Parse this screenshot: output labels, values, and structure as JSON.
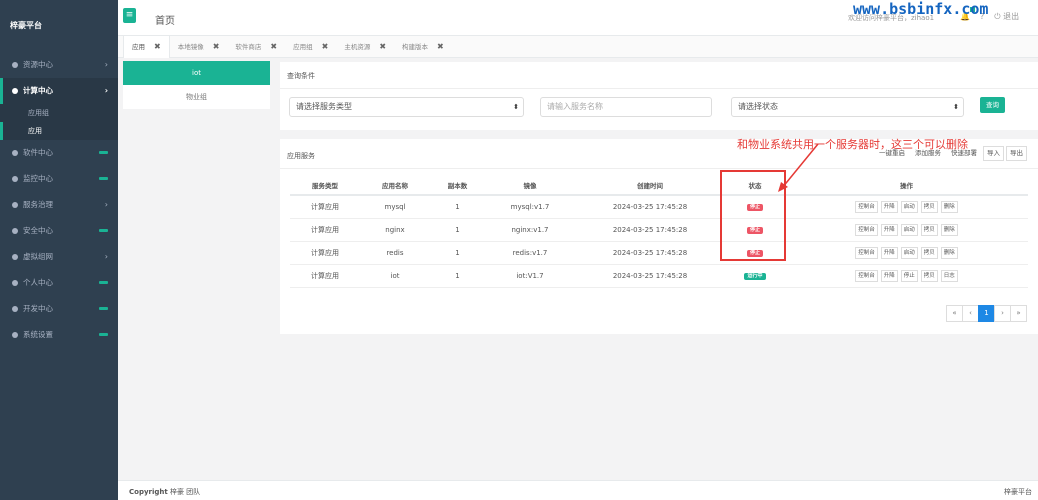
{
  "watermark": "www.bsbinfx.com",
  "sidebar": {
    "brand": "梓豪平台",
    "items": [
      {
        "label": "资源中心",
        "indicator": "arrow"
      },
      {
        "label": "计算中心",
        "indicator": "arrow",
        "active": true
      },
      {
        "label": "软件中心",
        "indicator": "bar"
      },
      {
        "label": "监控中心",
        "indicator": "bar"
      },
      {
        "label": "服务治理",
        "indicator": "arrow"
      },
      {
        "label": "安全中心",
        "indicator": "bar"
      },
      {
        "label": "虚拟组网",
        "indicator": "arrow"
      },
      {
        "label": "个人中心",
        "indicator": "bar"
      },
      {
        "label": "开发中心",
        "indicator": "bar"
      },
      {
        "label": "系统设置",
        "indicator": "bar"
      }
    ],
    "subitems": [
      "应用组",
      "应用"
    ],
    "arrow_glyph": "›"
  },
  "header": {
    "menu_icon": "≡",
    "title": "首页",
    "welcome": "欢迎访问梓豪平台，zihao1",
    "logout": "退出"
  },
  "tabs": [
    {
      "label": "应用",
      "active": true
    },
    {
      "label": "本地镜像"
    },
    {
      "label": "软件商店"
    },
    {
      "label": "应用组"
    },
    {
      "label": "主机资源"
    },
    {
      "label": "构建版本"
    }
  ],
  "tab_close": "✖",
  "left_panel": {
    "items": [
      "iot",
      "物业组"
    ]
  },
  "query": {
    "title": "查询条件",
    "service_type_placeholder": "请选择服务类型",
    "service_name_placeholder": "请输入服务名称",
    "status_placeholder": "请选择状态",
    "search_button": "查询",
    "caret": "⬍"
  },
  "services": {
    "title": "应用服务",
    "actions": [
      "一键重启",
      "添加服务",
      "快速部署",
      "导入",
      "导出"
    ],
    "columns": [
      "服务类型",
      "应用名称",
      "副本数",
      "镜像",
      "创建时间",
      "状态",
      "操作"
    ],
    "rows": [
      {
        "type": "计算应用",
        "name": "mysql",
        "replicas": "1",
        "image": "mysql:v1.7",
        "created": "2024-03-25 17:45:28",
        "status": "停止",
        "status_kind": "stop",
        "ops": [
          "控制台",
          "升降",
          "启动",
          "拷贝",
          "删除"
        ]
      },
      {
        "type": "计算应用",
        "name": "nginx",
        "replicas": "1",
        "image": "nginx:v1.7",
        "created": "2024-03-25 17:45:28",
        "status": "停止",
        "status_kind": "stop",
        "ops": [
          "控制台",
          "升降",
          "启动",
          "拷贝",
          "删除"
        ]
      },
      {
        "type": "计算应用",
        "name": "redis",
        "replicas": "1",
        "image": "redis:v1.7",
        "created": "2024-03-25 17:45:28",
        "status": "停止",
        "status_kind": "stop",
        "ops": [
          "控制台",
          "升降",
          "启动",
          "拷贝",
          "删除"
        ]
      },
      {
        "type": "计算应用",
        "name": "iot",
        "replicas": "1",
        "image": "iot:V1.7",
        "created": "2024-03-25 17:45:28",
        "status": "运行中",
        "status_kind": "run",
        "ops": [
          "控制台",
          "升降",
          "停止",
          "拷贝",
          "日志"
        ]
      }
    ]
  },
  "pagination": {
    "first": "«",
    "prev": "‹",
    "current": "1",
    "next": "›",
    "last": "»"
  },
  "annotation": {
    "text": "和物业系统共用一个服务器时，这三个可以删除",
    "color": "#e53935"
  },
  "footer": {
    "copyright_label": "Copyright",
    "team": "梓豪 团队",
    "brand": "梓豪平台"
  },
  "colors": {
    "accent": "#1ab394",
    "sidebar_bg": "#2f4050",
    "danger": "#ed5565",
    "primary": "#1e88e5"
  }
}
